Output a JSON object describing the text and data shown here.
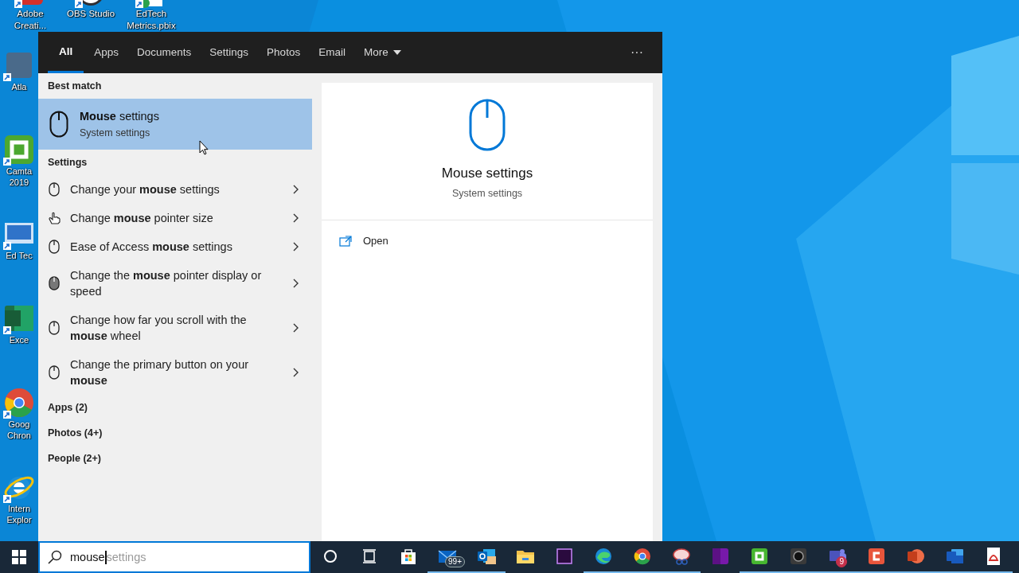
{
  "desktop": {
    "top_icons": [
      {
        "label": "Adobe Creati...",
        "kind": "adobe"
      },
      {
        "label": "OBS Studio",
        "kind": "obs"
      },
      {
        "label": "EdTech Metrics.pbix",
        "kind": "pbix"
      }
    ],
    "side_icons": [
      {
        "label": "Atla",
        "kind": "atlas"
      },
      {
        "label": "Camta 2019",
        "kind": "camtasia"
      },
      {
        "label": "Ed Tec",
        "kind": "edtech"
      },
      {
        "label": "Exce",
        "kind": "excel"
      },
      {
        "label": "Goog Chron",
        "kind": "chrome"
      },
      {
        "label": "Intern Explor",
        "kind": "ie"
      }
    ]
  },
  "search_panel": {
    "tabs": [
      {
        "label": "All",
        "selected": true
      },
      {
        "label": "Apps",
        "selected": false
      },
      {
        "label": "Documents",
        "selected": false
      },
      {
        "label": "Settings",
        "selected": false
      },
      {
        "label": "Photos",
        "selected": false
      },
      {
        "label": "Email",
        "selected": false
      },
      {
        "label": "More",
        "selected": false,
        "dropdown": true
      }
    ],
    "more_options": "···",
    "best_match": {
      "heading": "Best match",
      "title": "**Mouse** settings",
      "subtitle": "System settings",
      "selected": true
    },
    "settings": {
      "heading": "Settings",
      "items": [
        {
          "label": "Change your **mouse** settings",
          "kind": "mouse"
        },
        {
          "label": "Change **mouse** pointer size",
          "kind": "hand"
        },
        {
          "label": "Ease of Access **mouse** settings",
          "kind": "mouse"
        },
        {
          "label": "Change the **mouse** pointer display or speed",
          "kind": "filled"
        },
        {
          "label": "Change how far you scroll with the **mouse** wheel",
          "kind": "mouse"
        },
        {
          "label": "Change the primary button on your **mouse**",
          "kind": "mouse"
        }
      ]
    },
    "groups": [
      "Apps (2)",
      "Photos (4+)",
      "People (2+)"
    ],
    "preview": {
      "title": "Mouse settings",
      "subtitle": "System settings",
      "actions": [
        "Open"
      ]
    }
  },
  "taskbar": {
    "search": {
      "value": "mouse",
      "suggestion": "settings"
    },
    "apps": [
      {
        "kind": "cortana",
        "running": false
      },
      {
        "kind": "taskview",
        "running": false
      },
      {
        "kind": "store",
        "running": false
      },
      {
        "kind": "mail",
        "running": true,
        "badge": "99+"
      },
      {
        "kind": "outlook",
        "running": true
      },
      {
        "kind": "explorer",
        "running": false
      },
      {
        "kind": "premiere",
        "running": false
      },
      {
        "kind": "edge",
        "running": true
      },
      {
        "kind": "chrome",
        "running": true
      },
      {
        "kind": "snip",
        "running": true
      },
      {
        "kind": "onenote",
        "running": false
      },
      {
        "kind": "camtasia",
        "running": true
      },
      {
        "kind": "camera",
        "running": true
      },
      {
        "kind": "teams",
        "running": true,
        "badge": "9"
      },
      {
        "kind": "recorder",
        "running": true
      },
      {
        "kind": "powerpoint",
        "running": true
      },
      {
        "kind": "word",
        "running": true
      },
      {
        "kind": "acrobat",
        "running": true
      }
    ]
  }
}
